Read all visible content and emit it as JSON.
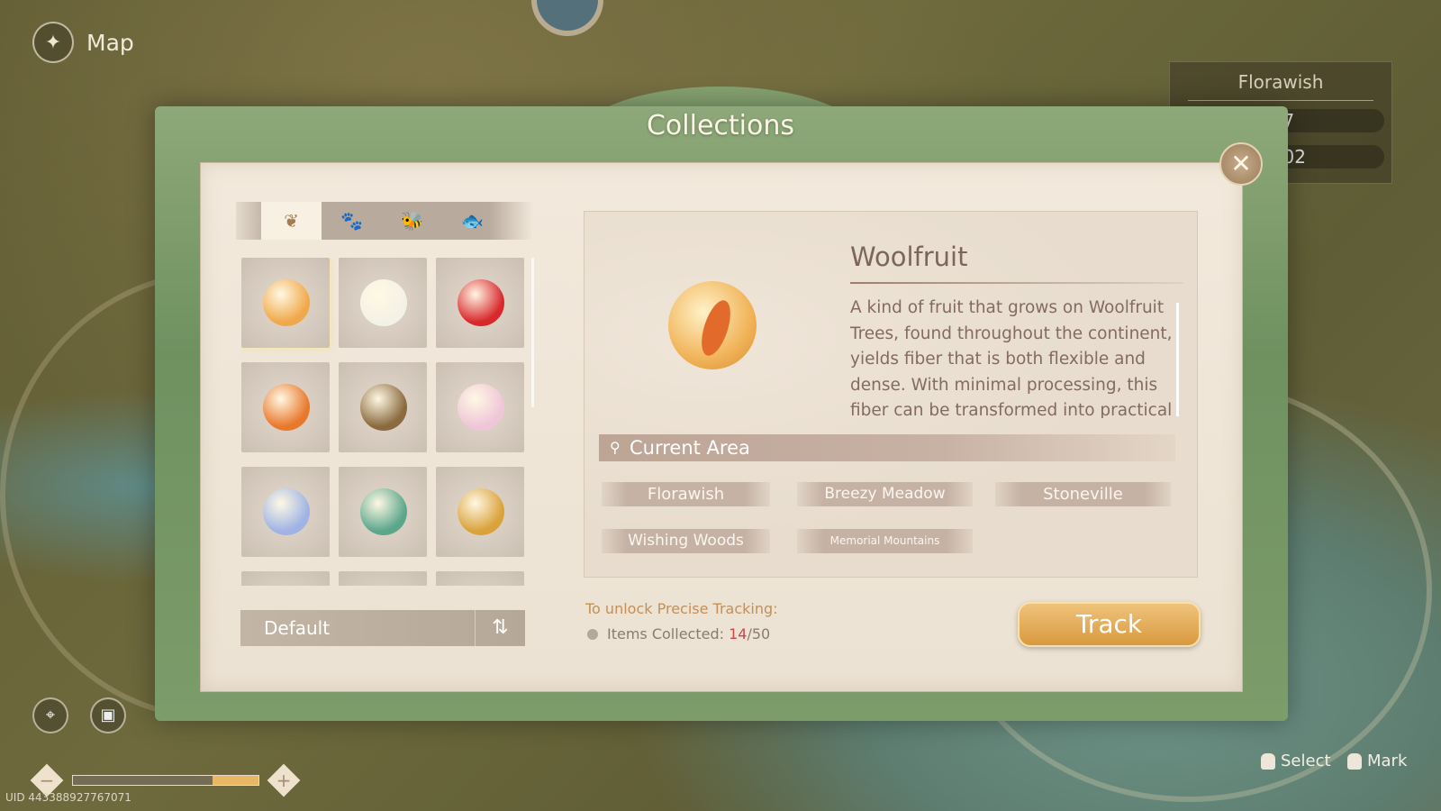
{
  "header": {
    "title": "Map",
    "back_icon": "map-back-icon"
  },
  "region_panel": {
    "title": "Florawish",
    "stat1": "/67",
    "stat2": "/302"
  },
  "modal": {
    "title": "Collections",
    "tabs": [
      {
        "icon": "plant-icon",
        "glyph": "❦",
        "active": true
      },
      {
        "icon": "paw-icon",
        "glyph": "🐾"
      },
      {
        "icon": "bee-icon",
        "glyph": "🐝"
      },
      {
        "icon": "fish-icon",
        "glyph": "🐟"
      }
    ],
    "grid_items": [
      {
        "name": "woolfruit",
        "color": "#f0a94a",
        "selected": true
      },
      {
        "name": "white-flower",
        "color": "#f4f2e6"
      },
      {
        "name": "red-pepper",
        "color": "#d8282c"
      },
      {
        "name": "orange-fruit",
        "color": "#e8782c"
      },
      {
        "name": "pinecone",
        "color": "#8a6a3e"
      },
      {
        "name": "pink-shell",
        "color": "#efc6d8"
      },
      {
        "name": "blue-shell",
        "color": "#9fb4e4"
      },
      {
        "name": "green-bulb",
        "color": "#5ca68c"
      },
      {
        "name": "golden-seed",
        "color": "#d9a23a"
      }
    ],
    "sort": {
      "label": "Default",
      "toggle_glyph": "⇅"
    },
    "detail": {
      "name": "Woolfruit",
      "description": "A kind of fruit that grows on Woolfruit Trees, found throughout the continent, yields fiber that is both flexible and dense. With minimal processing, this fiber can be transformed into practical",
      "current_area_label": "Current Area",
      "areas": [
        "Florawish",
        "Breezy Meadow",
        "Stoneville",
        "Wishing Woods",
        "Memorial Mountains"
      ]
    },
    "unlock_label": "To unlock Precise Tracking:",
    "items_collected_label": "Items Collected: ",
    "items_collected": "14",
    "items_total": "/50",
    "track_label": "Track",
    "close_glyph": "✕"
  },
  "footer": {
    "uid": "UID 443388927767071",
    "zoom_level": 0.25,
    "select_label": "Select",
    "mark_label": "Mark",
    "zoom_out": "−",
    "zoom_in": "+",
    "location_glyph": "⌖",
    "journal_glyph": "▣"
  },
  "colors": {
    "accent": "#d9993e",
    "frame": "#7c9c6a",
    "count_current": "#c44a4a"
  }
}
